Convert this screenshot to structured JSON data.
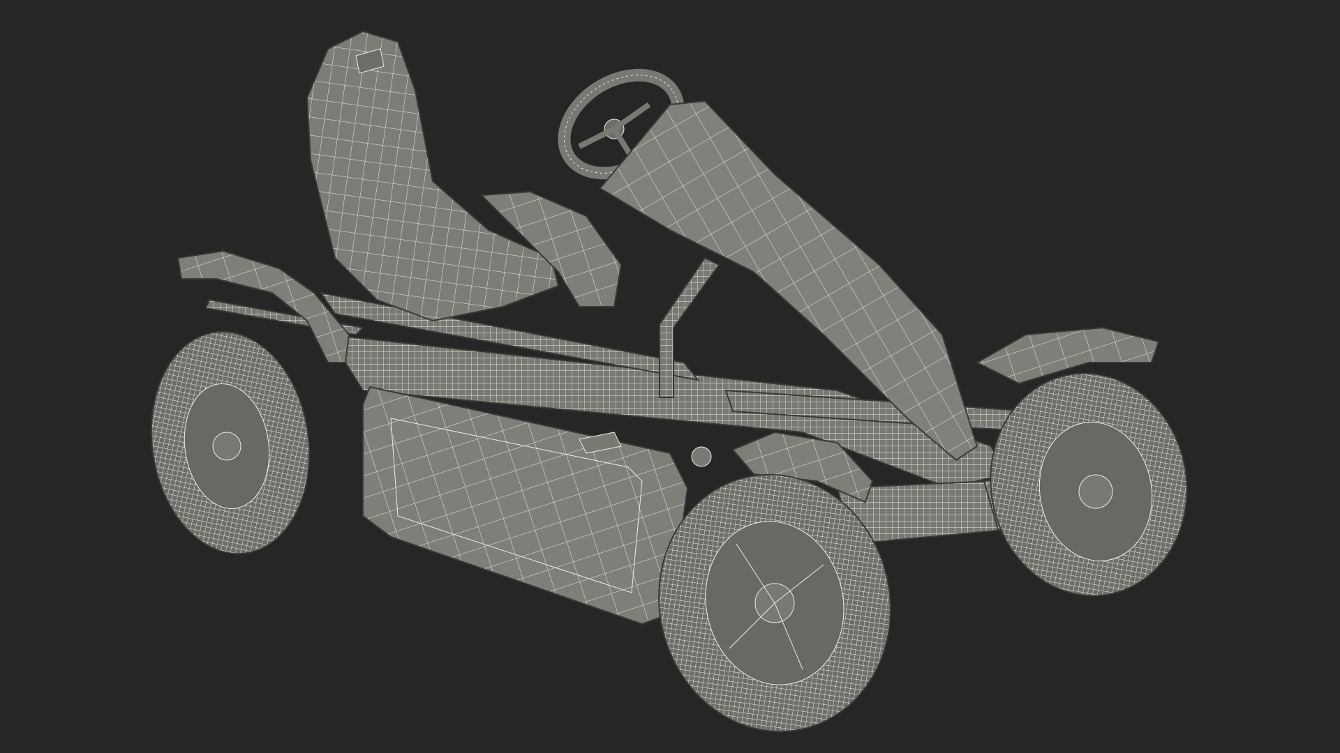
{
  "scene": {
    "subject": "wireframe-go-kart-render",
    "colors": {
      "background": "#262626",
      "body_fill": "#7e7c76",
      "body_fill_dark": "#6a6863",
      "body_fill_light": "#8d8b85",
      "wire": "#f2f2ec",
      "outline": "#3a3936"
    },
    "icons": [
      "go-kart-seat",
      "steering-wheel",
      "front-fairing",
      "side-panel",
      "wheel",
      "fender",
      "frame-tube"
    ]
  }
}
